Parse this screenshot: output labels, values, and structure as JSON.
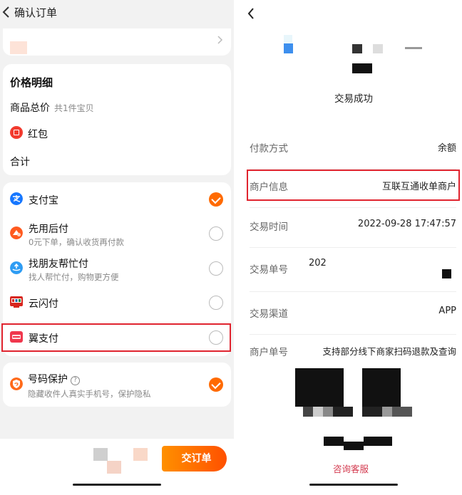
{
  "colors": {
    "accent": "#ff6a00",
    "highlight_border": "#e0242f",
    "contact_link": "#d3394e"
  },
  "left": {
    "header": {
      "title": "确认订单",
      "back_icon": "chevron-left-icon"
    },
    "price_detail": {
      "title": "价格明细",
      "goods_total_label": "商品总价",
      "goods_total_sub": "共1件宝贝",
      "red_packet_label": "红包",
      "total_label": "合计"
    },
    "payment_methods": [
      {
        "icon": "alipay-icon",
        "label": "支付宝",
        "sub": "",
        "selected": true
      },
      {
        "icon": "pay-later-icon",
        "label": "先用后付",
        "sub": "0元下单，确认收货再付款",
        "selected": false
      },
      {
        "icon": "friend-pay-icon",
        "label": "找朋友帮忙付",
        "sub": "找人帮忙付，购物更方便",
        "selected": false
      },
      {
        "icon": "unionpay-quickpass-icon",
        "label": "云闪付",
        "sub": "",
        "selected": false
      },
      {
        "icon": "bestpay-icon",
        "label": "翼支付",
        "sub": "",
        "selected": false
      }
    ],
    "number_protection": {
      "label": "号码保护",
      "help_glyph": "?",
      "sub": "隐藏收件人真实手机号，保护隐私",
      "enabled": true
    },
    "submit_button": "提交订单",
    "submit_visible": "交订单"
  },
  "right": {
    "status": "交易成功",
    "rows": [
      {
        "label": "付款方式",
        "value": "余额"
      },
      {
        "label": "商户信息",
        "value": "互联互通收单商户"
      },
      {
        "label": "交易时间",
        "value": "2022-09-28 17:47:57"
      },
      {
        "label": "交易单号",
        "value": "202"
      },
      {
        "label": "交易渠道",
        "value": "APP"
      },
      {
        "label": "商户单号",
        "value": "支持部分线下商家扫码退款及查询"
      }
    ],
    "contact_link": "咨询客服"
  }
}
